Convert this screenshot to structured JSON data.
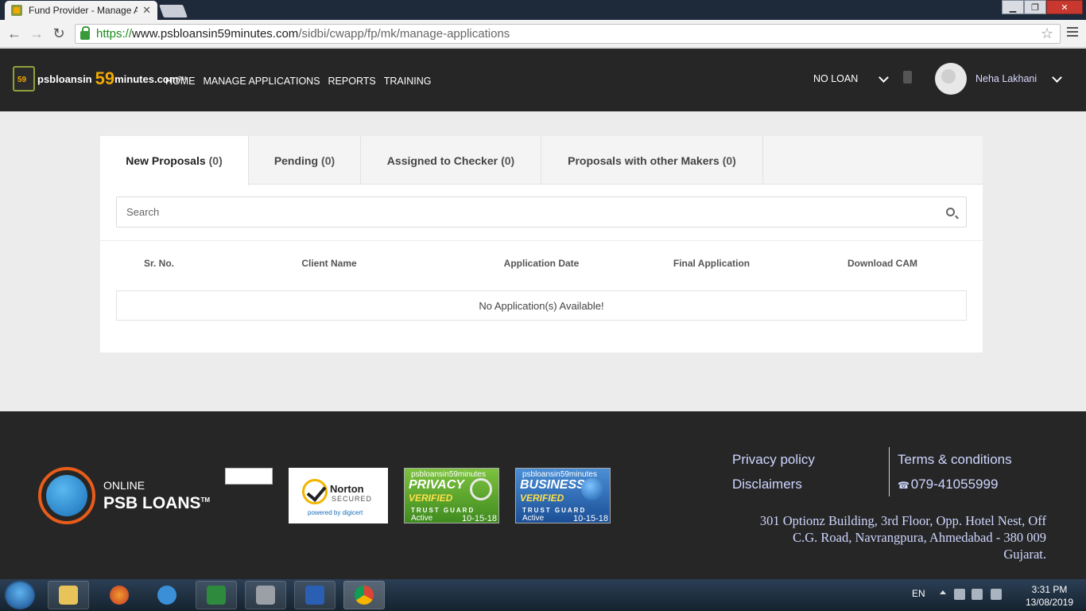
{
  "browser": {
    "tab_title": "Fund Provider - Manage A",
    "tab_close": "✕",
    "url_scheme": "https://",
    "url_host": "www.psbloansin59minutes.com",
    "url_path": "/sidbi/cwapp/fp/mk/manage-applications",
    "minimize": "▁",
    "maximize": "❐",
    "close": "✕"
  },
  "brand": {
    "part1": "psbloansin",
    "part2": "59",
    "part3": "minutes.com",
    "tm": "TM",
    "mark_text": "59"
  },
  "nav": {
    "items": [
      {
        "label": "HOME"
      },
      {
        "label": "MANAGE APPLICATIONS"
      },
      {
        "label": "REPORTS"
      },
      {
        "label": "TRAINING"
      }
    ]
  },
  "header_right": {
    "loan_selector": "NO LOAN",
    "user_name": "Neha Lakhani"
  },
  "tabs": [
    {
      "label": "New Proposals",
      "count": "(0)"
    },
    {
      "label": "Pending",
      "count": "(0)"
    },
    {
      "label": "Assigned to Checker",
      "count": "(0)"
    },
    {
      "label": "Proposals with other Makers",
      "count": "(0)"
    }
  ],
  "search": {
    "placeholder": "Search"
  },
  "table": {
    "columns": [
      "Sr. No.",
      "Client Name",
      "Application Date",
      "Final Application",
      "Download CAM"
    ],
    "empty_message": "No Application(s) Available!"
  },
  "footer": {
    "psb_line1": "ONLINE",
    "psb_line2": "PSB LOANS",
    "psb_tm": "TM",
    "norton_name": "Norton",
    "norton_secured": "SECURED",
    "norton_powered": "powered by digicert",
    "privacy_badge": {
      "site": "psbloansin59minutes",
      "title": "PRIVACY",
      "verified": "VERIFIED",
      "brand": "TRUST GUARD",
      "status": "Active",
      "date": "10-15-18"
    },
    "business_badge": {
      "site": "psbloansin59minutes",
      "title": "BUSINESS",
      "verified": "VERIFIED",
      "brand": "TRUST GUARD",
      "status": "Active",
      "date": "10-15-18"
    },
    "privacy_policy": "Privacy policy",
    "terms": "Terms & conditions",
    "disclaimers": "Disclaimers",
    "phone": "079-41055999",
    "address_line1": "301 Optionz Building, 3rd Floor, Opp. Hotel Nest, Off",
    "address_line2": "C.G. Road, Navrangpura, Ahmedabad - 380 009",
    "address_line3": "Gujarat."
  },
  "taskbar": {
    "lang": "EN",
    "time": "3:31 PM",
    "date": "13/08/2019"
  }
}
